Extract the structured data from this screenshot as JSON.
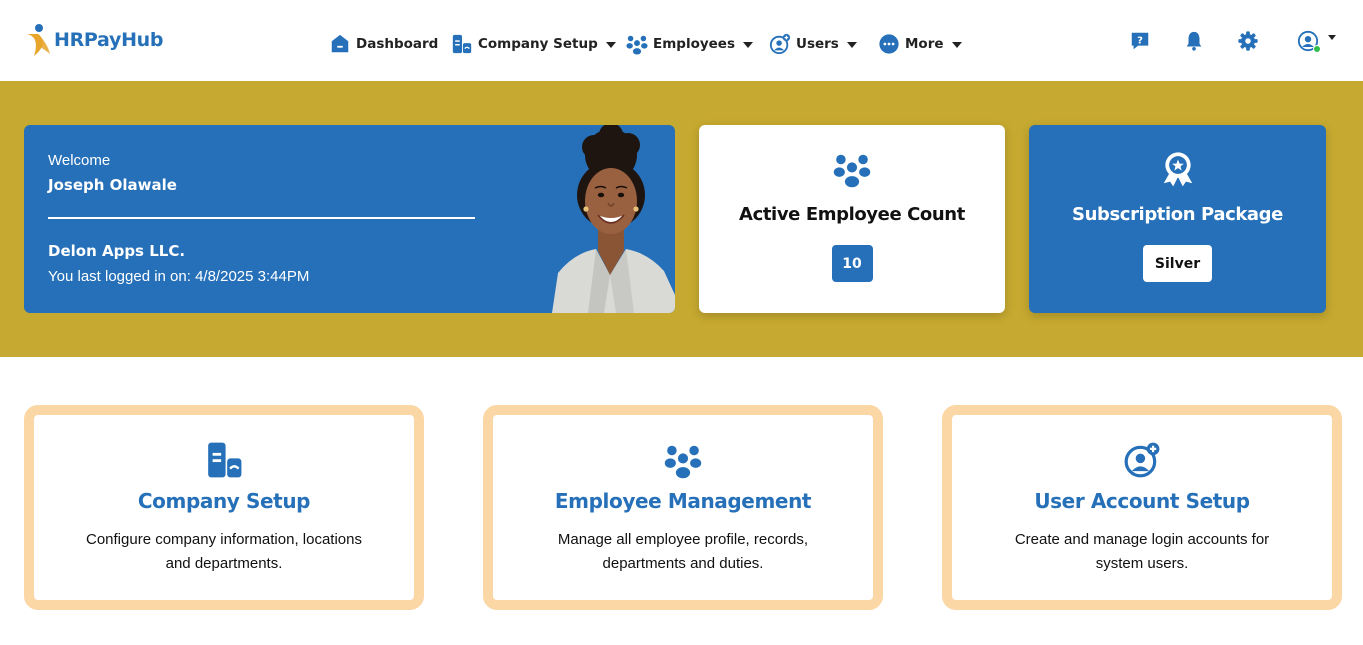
{
  "app": {
    "name": "HRPayHub"
  },
  "nav": {
    "items": [
      {
        "label": "Dashboard",
        "icon": "home-icon",
        "dropdown": false
      },
      {
        "label": "Company Setup",
        "icon": "company-icon",
        "dropdown": true
      },
      {
        "label": "Employees",
        "icon": "people-icon",
        "dropdown": true
      },
      {
        "label": "Users",
        "icon": "user-add-icon",
        "dropdown": true
      },
      {
        "label": "More",
        "icon": "more-icon",
        "dropdown": true
      }
    ]
  },
  "header_icons": [
    "help-icon",
    "bell-icon",
    "gear-icon",
    "profile-icon"
  ],
  "welcome": {
    "label": "Welcome",
    "name": "Joseph Olawale",
    "company": "Delon Apps LLC.",
    "last_login_label": "You last logged in on:",
    "last_login_value": "4/8/2025 3:44PM"
  },
  "stats": {
    "employees": {
      "title": "Active Employee Count",
      "value": "10"
    },
    "subscription": {
      "title": "Subscription Package",
      "value": "Silver"
    }
  },
  "features": [
    {
      "title": "Company Setup",
      "description": "Configure company information, locations and departments."
    },
    {
      "title": "Employee Management",
      "description": "Manage all employee profile, records, departments and duties."
    },
    {
      "title": "User Account Setup",
      "description": "Create and manage login accounts for system users."
    }
  ],
  "colors": {
    "primary": "#2570b8",
    "banner": "#c6a930",
    "feature_border": "#fbd7a6",
    "online": "#2fbf4a"
  }
}
